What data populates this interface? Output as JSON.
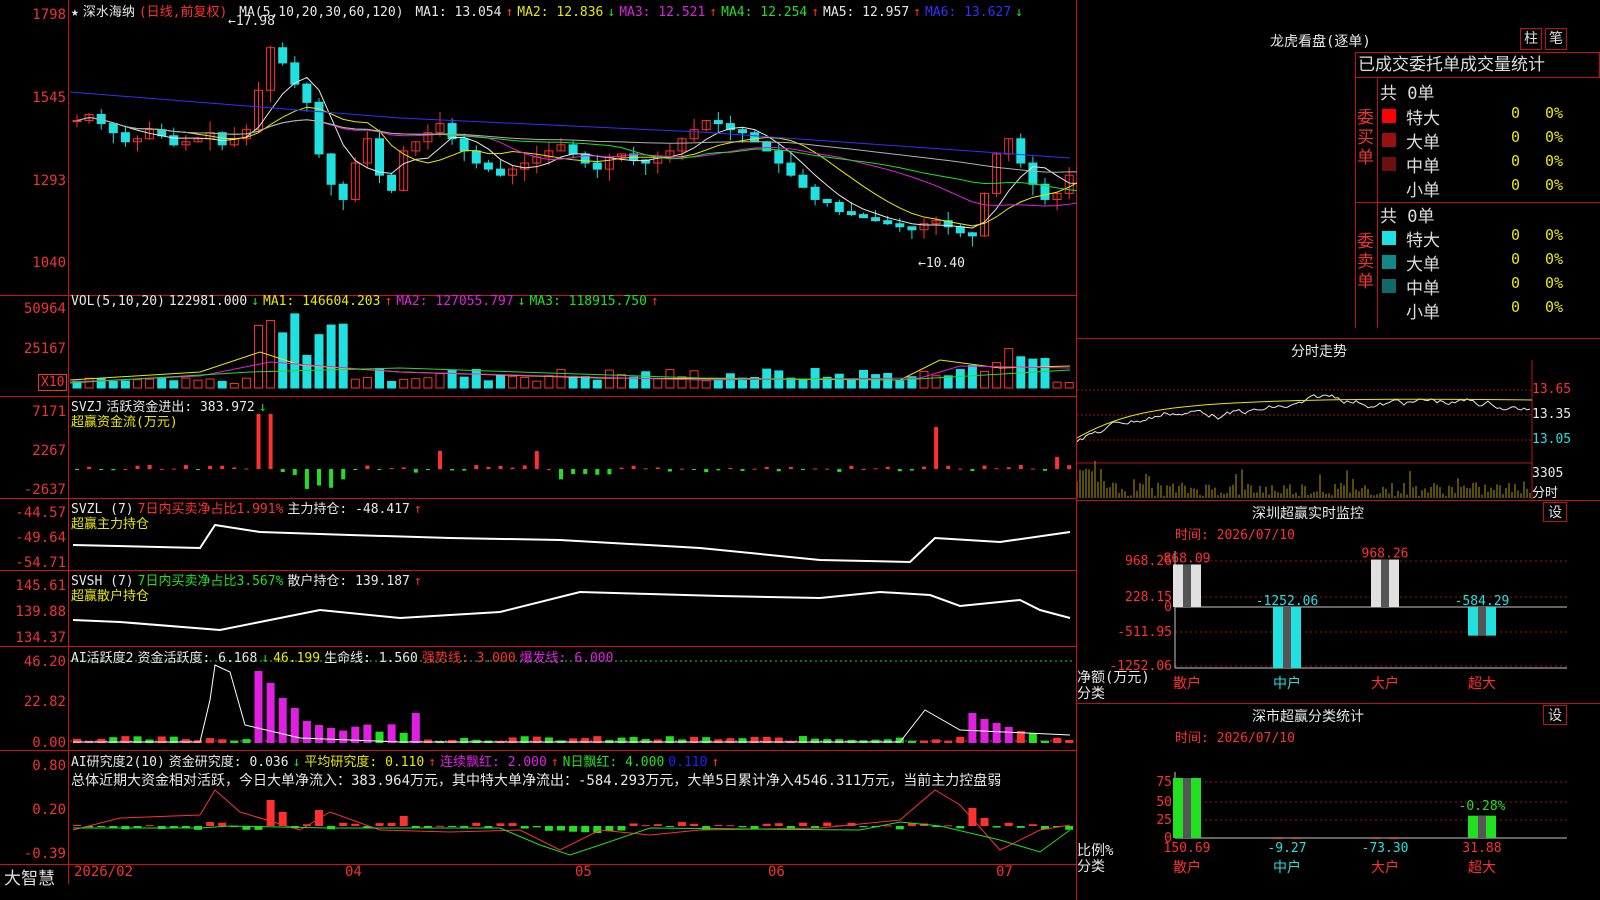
{
  "main": {
    "star": "★",
    "stock": "深水海纳",
    "period": "(日线,前复权)",
    "ma_label": "MA(5,10,20,30,60,120)",
    "ma": [
      {
        "t": "MA1: 13.054",
        "a": "↑",
        "c": "#e8e8e8"
      },
      {
        "t": "MA2: 12.836",
        "a": "↓",
        "c": "#e8e800"
      },
      {
        "t": "MA3: 12.521",
        "a": "↑",
        "c": "#e020e0"
      },
      {
        "t": "MA4: 12.254",
        "a": "↑",
        "c": "#20e020"
      },
      {
        "t": "MA5: 12.957",
        "a": "↑",
        "c": "#e8e8e8"
      },
      {
        "t": "MA6: 13.627",
        "a": "↓",
        "c": "#3030ff"
      }
    ],
    "yaxis": [
      "1798",
      "1545",
      "1293",
      "1040"
    ],
    "hi": "←17.98",
    "lo": "←10.40"
  },
  "vol": {
    "title": "VOL(5,10,20)",
    "v": "122981.000",
    "a": "↓",
    "ma1": "MA1: 146604.203",
    "ma1a": "↑",
    "ma2": "MA2: 127055.797",
    "ma2a": "↓",
    "ma3": "MA3: 118915.750",
    "ma3a": "↑",
    "yaxis": [
      "50964",
      "25167"
    ],
    "x10": "X10"
  },
  "svzj": {
    "title": "SVZJ",
    "label": "活跃资金进出: 383.972",
    "a": "↓",
    "sub": "超赢资金流(万元)",
    "yaxis": [
      "7171",
      "2267",
      "-2637"
    ]
  },
  "svzl": {
    "title": "SVZL (7)",
    "pct": "7日内买卖净占比1.991%",
    "hold": "主力持仓: -48.417",
    "a": "↑",
    "sub": "超赢主力持仓",
    "yaxis": [
      "-44.57",
      "-49.64",
      "-54.71"
    ]
  },
  "svsh": {
    "title": "SVSH (7)",
    "pct": "7日内买卖净占比3.567%",
    "hold": "散户持仓: 139.187",
    "a": "↑",
    "sub": "超赢散户持仓",
    "yaxis": [
      "145.61",
      "139.88",
      "134.37"
    ]
  },
  "ai1": {
    "title": "AI活跃度2",
    "a1": "资金活跃度: 6.168",
    "a1a": "↓",
    "a2": "46.199",
    "a3": "生命线: 1.560",
    "a4": "强势线: 3.000",
    "a5": "爆发线: 6.000",
    "yaxis": [
      "46.20",
      "22.82",
      "0.00"
    ]
  },
  "ai2": {
    "title": "AI研究度2(10)",
    "b1": "资金研究度: 0.036",
    "b1a": "↓",
    "b2": "平均研究度: 0.110",
    "b2a": "↑",
    "b3": "连续飘红: 2.000",
    "b3a": "↑",
    "b4": "N日飘红: 4.000",
    "b5": "0.110",
    "b5a": "↑",
    "summary": "总体近期大资金相对活跃，今日大单净流入：383.964万元，其中特大单净流出：-584.293万元，大单5日累计净入4546.311万元，当前主力控盘弱",
    "yaxis": [
      "0.80",
      "0.20",
      "-0.39"
    ]
  },
  "xaxis": [
    "2026/02",
    "04",
    "05",
    "06",
    "07"
  ],
  "brand": "大智慧",
  "right": {
    "title": "龙虎看盘(逐单)",
    "b1": "柱",
    "b2": "笔",
    "tab": "已成交委托单成交量统计",
    "buy": {
      "label": "委买单",
      "total": "共 0单",
      "rows": [
        {
          "n": "特大",
          "v": "0",
          "p": "0%"
        },
        {
          "n": "大单",
          "v": "0",
          "p": "0%"
        },
        {
          "n": "中单",
          "v": "0",
          "p": "0%"
        },
        {
          "n": "小单",
          "v": "0",
          "p": "0%"
        }
      ]
    },
    "sell": {
      "label": "委卖单",
      "total": "共 0单",
      "rows": [
        {
          "n": "特大",
          "v": "0",
          "p": "0%"
        },
        {
          "n": "大单",
          "v": "0",
          "p": "0%"
        },
        {
          "n": "中单",
          "v": "0",
          "p": "0%"
        },
        {
          "n": "小单",
          "v": "0",
          "p": "0%"
        }
      ]
    },
    "intraday": {
      "title": "分时走势",
      "p": [
        "13.65",
        "13.35",
        "13.05"
      ],
      "vol": "3305",
      "unit": "分时"
    },
    "sz": {
      "title": "深圳超赢实时监控",
      "set": "设",
      "time": "时间: 2026/07/10",
      "y": [
        "968.26",
        "228.15",
        "0",
        "-511.95",
        "-1252.06"
      ],
      "ylabel": "净额(万元)",
      "xlabel": "分类",
      "vals": [
        "868.09",
        "-1252.06",
        "968.26",
        "-584.29"
      ],
      "cats": [
        "散户",
        "中户",
        "大户",
        "超大"
      ]
    },
    "cls": {
      "title": "深市超赢分类统计",
      "set": "设",
      "time": "时间: 2026/07/10",
      "y": [
        "75",
        "50",
        "25",
        "0"
      ],
      "ylabel": "比例%",
      "xlabel": "分类",
      "top": "-0.28%",
      "vals": [
        "150.69",
        "-9.27",
        "-73.30",
        "31.88"
      ],
      "cats": [
        "散户",
        "中户",
        "大户",
        "超大"
      ]
    }
  }
}
